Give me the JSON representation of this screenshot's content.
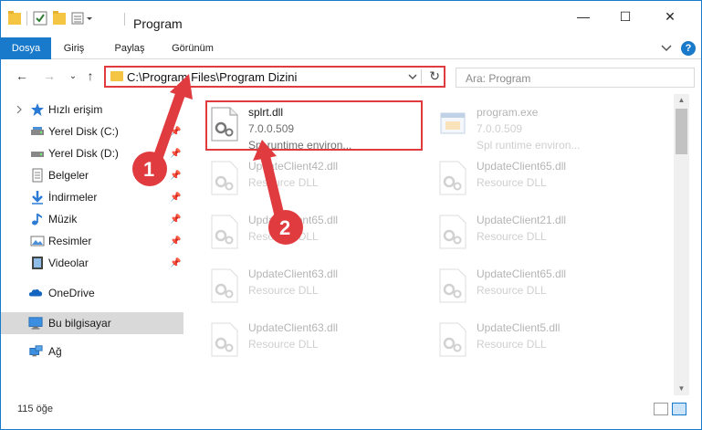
{
  "window": {
    "title": "Program",
    "controls": {
      "minimize": "—",
      "maximize": "☐",
      "close": "✕"
    }
  },
  "ribbon": {
    "tabs": [
      "Dosya",
      "Giriş",
      "Paylaş",
      "Görünüm"
    ],
    "help": "?"
  },
  "nav": {
    "back": "←",
    "forward": "→",
    "recent": "⌄",
    "up": "↑",
    "address": "C:\\Program Files\\Program Dizini",
    "refresh": "↻",
    "search_placeholder": "Ara: Program"
  },
  "sidebar": {
    "items": [
      {
        "label": "Hızlı erişim",
        "icon": "star-icon"
      },
      {
        "label": "Yerel Disk (C:)",
        "icon": "drive-icon",
        "pinned": true
      },
      {
        "label": "Yerel Disk (D:)",
        "icon": "drive-icon",
        "pinned": true
      },
      {
        "label": "Belgeler",
        "icon": "documents-icon",
        "pinned": true
      },
      {
        "label": "İndirmeler",
        "icon": "download-icon",
        "pinned": true
      },
      {
        "label": "Müzik",
        "icon": "music-icon",
        "pinned": true
      },
      {
        "label": "Resimler",
        "icon": "pictures-icon",
        "pinned": true
      },
      {
        "label": "Videolar",
        "icon": "videos-icon",
        "pinned": true
      },
      {
        "label": "OneDrive",
        "icon": "cloud-icon"
      },
      {
        "label": "Bu bilgisayar",
        "icon": "computer-icon",
        "selected": true
      },
      {
        "label": "Ağ",
        "icon": "network-icon"
      }
    ]
  },
  "files": [
    {
      "name": "splrt.dll",
      "line2": "7.0.0.509",
      "line3": "Spl runtime environ...",
      "highlighted": true
    },
    {
      "name": "program.exe",
      "line2": "7.0.0.509",
      "line3": "Spl runtime environ..."
    },
    {
      "name": "UpdateClient42.dll",
      "line2": "Resource DLL"
    },
    {
      "name": "UpdateClient65.dll",
      "line2": "Resource DLL"
    },
    {
      "name": "UpdateClient65.dll",
      "line2": "Resource DLL"
    },
    {
      "name": "UpdateClient21.dll",
      "line2": "Resource DLL"
    },
    {
      "name": "UpdateClient63.dll",
      "line2": "Resource DLL"
    },
    {
      "name": "UpdateClient65.dll",
      "line2": "Resource DLL"
    },
    {
      "name": "UpdateClient63.dll",
      "line2": "Resource DLL"
    },
    {
      "name": "UpdateClient5.dll",
      "line2": "Resource DLL"
    }
  ],
  "status": {
    "count": "115 öğe"
  },
  "annotations": {
    "step1": "1",
    "step2": "2"
  },
  "colors": {
    "accent": "#1979ca",
    "annotation": "#e03b3f",
    "folder": "#f4c542"
  }
}
